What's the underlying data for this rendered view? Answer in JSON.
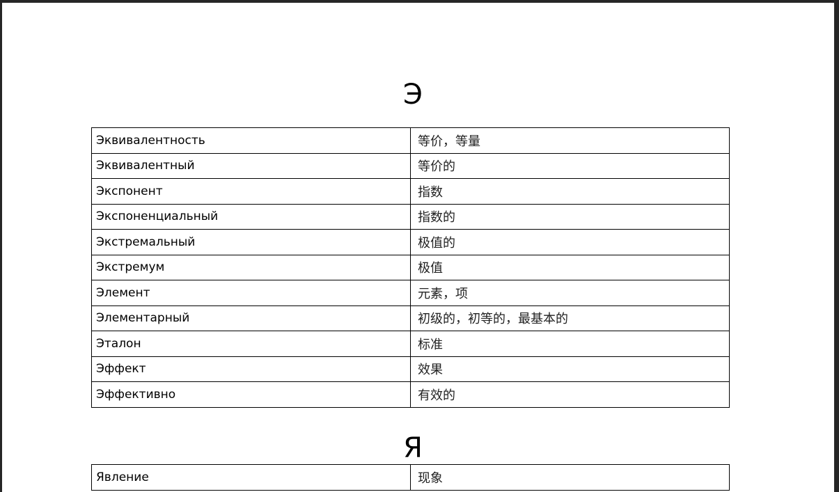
{
  "sections": [
    {
      "letter": "Э",
      "rows": [
        {
          "ru": "Эквивалентность",
          "zh": "等价，等量"
        },
        {
          "ru": "Эквивалентный",
          "zh": "等价的"
        },
        {
          "ru": "Экспонент",
          "zh": "指数"
        },
        {
          "ru": "Экспоненциальный",
          "zh": "指数的"
        },
        {
          "ru": "Экстремальный",
          "zh": "极值的"
        },
        {
          "ru": "Экстремум",
          "zh": "极值"
        },
        {
          "ru": "Элемент",
          "zh": "元素，项"
        },
        {
          "ru": "Элементарный",
          "zh": "初级的，初等的，最基本的"
        },
        {
          "ru": "Эталон",
          "zh": "标准"
        },
        {
          "ru": "Эффект",
          "zh": "效果"
        },
        {
          "ru": "Эффективно",
          "zh": "有效的"
        }
      ]
    },
    {
      "letter": "Я",
      "rows": [
        {
          "ru": "Явление",
          "zh": "现象"
        }
      ]
    }
  ]
}
